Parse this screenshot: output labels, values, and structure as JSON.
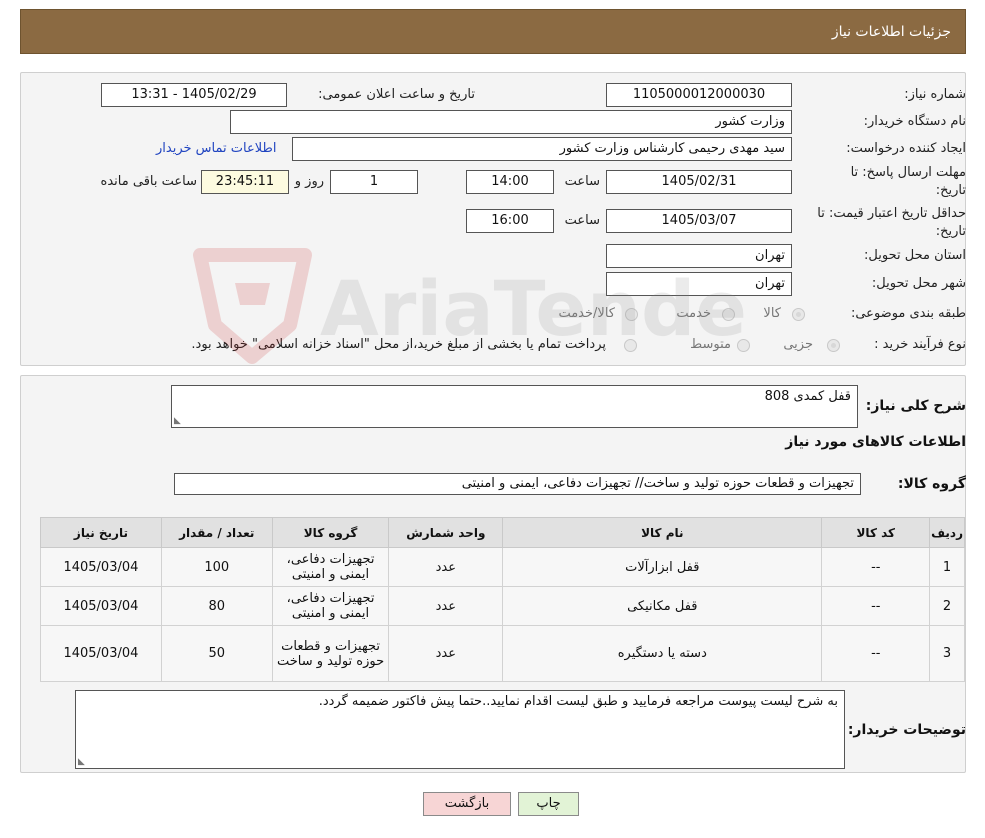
{
  "header": {
    "title": "جزئیات اطلاعات نیاز"
  },
  "info": {
    "need_number_label": "شماره نیاز:",
    "need_number": "1105000012000030",
    "announce_label": "تاریخ و ساعت اعلان عمومی:",
    "announce_value": "1405/02/29 - 13:31",
    "buyer_label": "نام دستگاه خریدار:",
    "buyer_value": "وزارت کشور",
    "creator_label": "ایجاد کننده درخواست:",
    "creator_value": "سید مهدی رحیمی کارشناس وزارت کشور",
    "contact_link": "اطلاعات تماس خریدار",
    "deadline_label_line1": "مهلت ارسال پاسخ: تا",
    "deadline_label_line2": "تاریخ:",
    "deadline_date": "1405/02/31",
    "time_label": "ساعت",
    "deadline_time": "14:00",
    "days_value": "1",
    "days_label": "روز و",
    "remaining_time": "23:45:11",
    "remaining_label": "ساعت باقی مانده",
    "validity_label_line1": "حداقل تاریخ اعتبار قیمت: تا",
    "validity_label_line2": "تاریخ:",
    "validity_date": "1405/03/07",
    "validity_time": "16:00",
    "province_label": "استان محل تحویل:",
    "province_value": "تهران",
    "city_label": "شهر محل تحویل:",
    "city_value": "تهران",
    "category_label": "طبقه بندی موضوعی:",
    "category_options": [
      "کالا",
      "خدمت",
      "کالا/خدمت"
    ],
    "process_label": "نوع فرآیند خرید :",
    "process_options": [
      "جزیی",
      "متوسط"
    ],
    "process_note": "پرداخت تمام یا بخشی از مبلغ خرید،از محل \"اسناد خزانه اسلامی\" خواهد بود."
  },
  "details": {
    "summary_label": "شرح کلی نیاز:",
    "summary_value": "قفل کمدی 808",
    "goods_info_title": "اطلاعات کالاهای مورد نیاز",
    "goods_group_label": "گروه کالا:",
    "goods_group_value": "تجهیزات و قطعات حوزه تولید و ساخت// تجهیزات دفاعی، ایمنی و امنیتی",
    "table": {
      "headers": [
        "ردیف",
        "کد کالا",
        "نام کالا",
        "واحد شمارش",
        "گروه کالا",
        "تعداد / مقدار",
        "تاریخ نیاز"
      ],
      "rows": [
        [
          "1",
          "--",
          "قفل ابزارآلات",
          "عدد",
          "تجهیزات دفاعی، ایمنی و امنیتی",
          "100",
          "1405/03/04"
        ],
        [
          "2",
          "--",
          "قفل مکانیکی",
          "عدد",
          "تجهیزات دفاعی، ایمنی و امنیتی",
          "80",
          "1405/03/04"
        ],
        [
          "3",
          "--",
          "دسته یا دستگیره",
          "عدد",
          "تجهیزات و قطعات حوزه تولید و ساخت",
          "50",
          "1405/03/04"
        ]
      ]
    },
    "buyer_notes_label": "توضیحات خریدار:",
    "buyer_notes_value": "به شرح لیست پیوست مراجعه فرمایید و طبق لیست اقدام نمایید..حتما پیش فاکتور ضمیمه گردد."
  },
  "buttons": {
    "print": "چاپ",
    "back": "بازگشت"
  },
  "watermark": {
    "text": "AriaTender.neT"
  },
  "colors": {
    "header": "#8b6a42",
    "link": "#2044c0",
    "back_button": "#f7d5d5",
    "print_button": "#e2f3d6"
  }
}
